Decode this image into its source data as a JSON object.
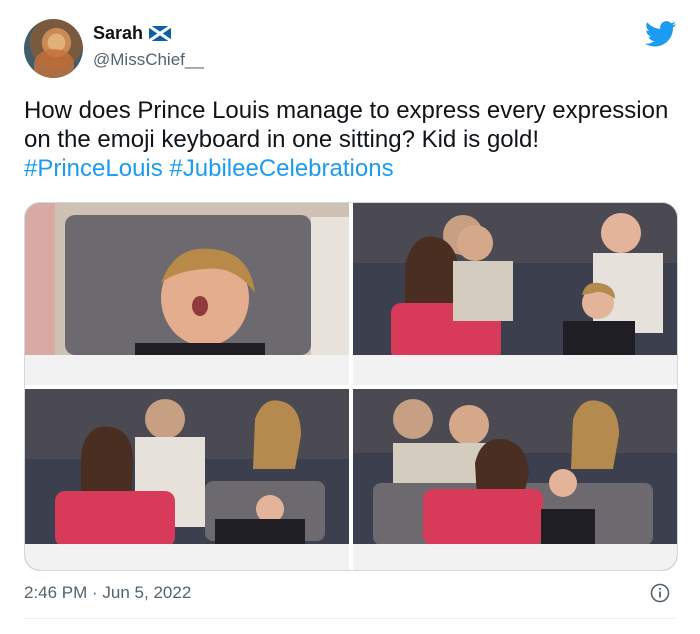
{
  "author": {
    "display_name": "Sarah",
    "handle": "@MissChief__"
  },
  "icons": {
    "flag": "scotland-flag-icon",
    "platform": "twitter-bird-icon",
    "info": "info-icon"
  },
  "tweet": {
    "text_main": "How does Prince Louis manage to express every expression on the emoji keyboard in one sitting? Kid is gold!",
    "hashtags": [
      "#PrinceLouis",
      "#JubileeCelebrations"
    ],
    "timestamp": "2:46 PM · Jun 5, 2022"
  },
  "colors": {
    "link": "#1d9bf0",
    "twitter_blue": "#1d9bf0",
    "secondary_text": "#536471"
  }
}
